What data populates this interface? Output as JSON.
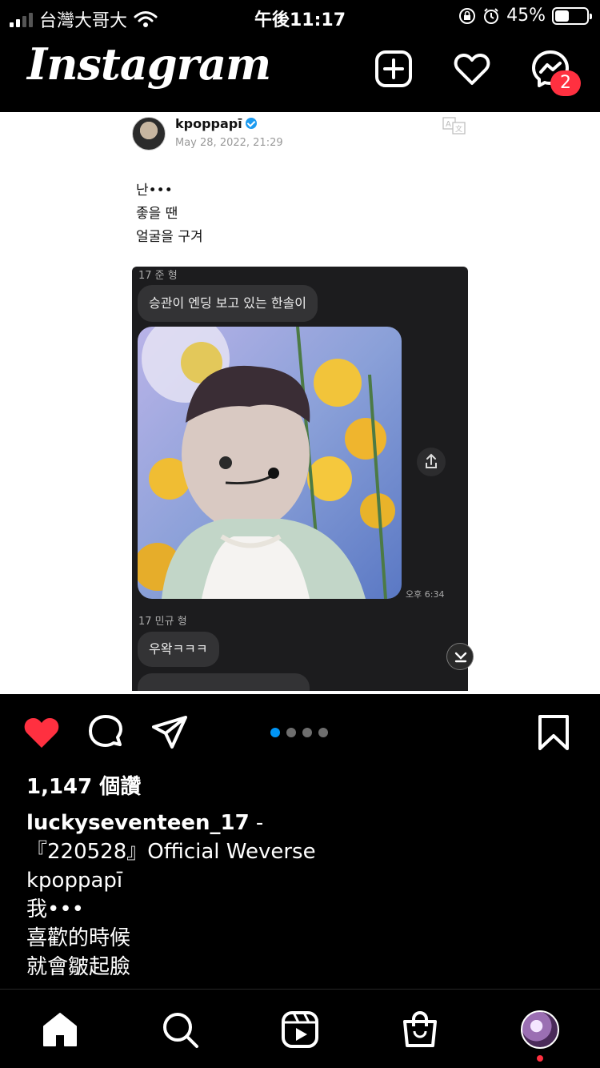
{
  "status_bar": {
    "carrier": "台灣大哥大",
    "time": "午後11:17",
    "battery": "45%",
    "battery_level": 0.45,
    "signal_bars_filled": 2,
    "icons": [
      "signal-icon",
      "wifi-icon",
      "orientation-lock-icon",
      "alarm-icon",
      "battery-icon"
    ]
  },
  "header": {
    "logo": "Instagram",
    "icons": [
      "new-post-icon",
      "heart-icon",
      "messenger-icon"
    ],
    "messenger_badge": "2",
    "badge_color": "#ff3040"
  },
  "post_image": {
    "author": "kpoppapī",
    "date": "May 28, 2022, 21:29",
    "text_lines": [
      "난•••",
      "좋을 땐",
      "얼굴을 구겨"
    ],
    "chat": {
      "sender1": "17 준 형",
      "message1": "승관이 엔딩 보고 있는 한솔이",
      "photo_time": "오후 6:34",
      "sender2": "17 민규 형",
      "message2": "우왁ㅋㅋㅋ"
    }
  },
  "actions": {
    "icons": [
      "like-heart-icon",
      "comment-icon",
      "share-icon",
      "bookmark-icon"
    ],
    "like_color": "#ff3040",
    "carousel_total": 4,
    "carousel_active": 1,
    "carousel_active_color": "#0095f6"
  },
  "likes": "1,147 個讚",
  "caption": {
    "username": "luckyseventeen_17",
    "dash": " -",
    "lines": [
      "『220528』Official Weverse",
      "kpoppapī",
      "我•••",
      "喜歡的時候",
      "就會皺起臉"
    ]
  },
  "tab_bar": {
    "icons": [
      "home-icon",
      "search-icon",
      "reels-icon",
      "shop-icon",
      "profile-avatar"
    ]
  }
}
